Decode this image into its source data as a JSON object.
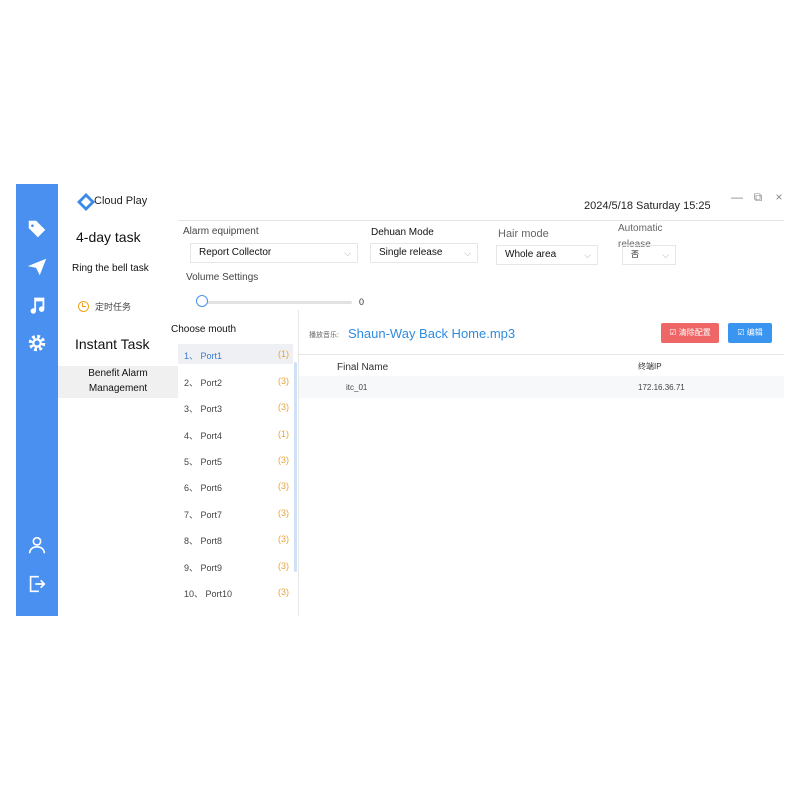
{
  "window": {
    "title": "Cloud Play",
    "datetime": "2024/5/18 Saturday 15:25",
    "minimize": "—",
    "restore": "⧉",
    "close": "×"
  },
  "rail": {
    "icons": [
      "tag-icon",
      "send-icon",
      "music-icon",
      "settings-icon",
      "user-icon",
      "logout-icon"
    ]
  },
  "nav": {
    "section1": "4-day task",
    "item_bell": "Ring the bell task",
    "item_timer": "定时任务",
    "section2": "Instant Task",
    "item_alarm": "Benefit Alarm\nManagement"
  },
  "settings": {
    "alarm_equipment_label": "Alarm equipment",
    "alarm_equipment_value": "Report Collector",
    "dehuan_label": "Dehuan Mode",
    "dehuan_value": "Single release",
    "hair_label": "Hair mode",
    "hair_value": "Whole area",
    "auto_label": "Automatic release",
    "auto_value": "否",
    "volume_label": "Volume Settings",
    "volume_value": "0"
  },
  "ports": {
    "title": "Choose mouth",
    "items": [
      {
        "label": "1、 Port1",
        "count": "(1)"
      },
      {
        "label": "2、 Port2",
        "count": "(3)"
      },
      {
        "label": "3、 Port3",
        "count": "(3)"
      },
      {
        "label": "4、 Port4",
        "count": "(1)"
      },
      {
        "label": "5、 Port5",
        "count": "(3)"
      },
      {
        "label": "6、 Port6",
        "count": "(3)"
      },
      {
        "label": "7、 Port7",
        "count": "(3)"
      },
      {
        "label": "8、 Port8",
        "count": "(3)"
      },
      {
        "label": "9、 Port9",
        "count": "(3)"
      },
      {
        "label": "10、 Port10",
        "count": "(3)"
      }
    ]
  },
  "detail": {
    "music_prefix": "播放音乐:",
    "music_name": "Shaun-Way Back Home.mp3",
    "clear_button": "清除配置",
    "edit_button": "编辑",
    "columns": [
      "Final Name",
      "终端IP"
    ],
    "rows": [
      {
        "name": "itc_01",
        "ip": "172.16.36.71"
      }
    ]
  }
}
